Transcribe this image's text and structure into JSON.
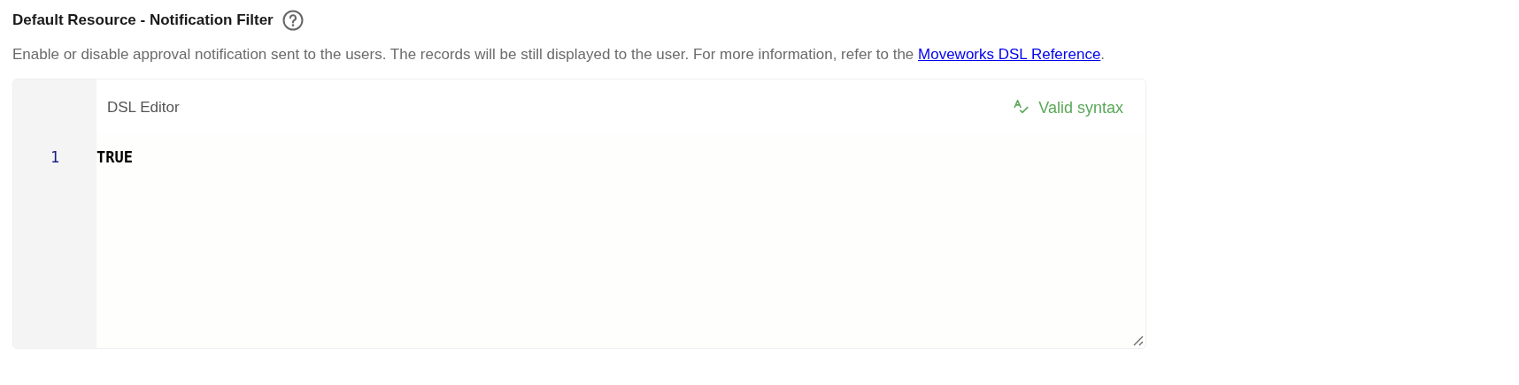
{
  "field": {
    "title": "Default Resource - Notification Filter",
    "description": "Enable or disable approval notification sent to the users. The records will be still displayed to the user. For more information, refer to the ",
    "link": "Moveworks DSL Reference",
    "description_end": "."
  },
  "editor": {
    "label": "DSL Editor",
    "status": {
      "kind": "valid",
      "text": "Valid syntax"
    },
    "lines": [
      {
        "number": "1",
        "code": "TRUE"
      }
    ]
  }
}
